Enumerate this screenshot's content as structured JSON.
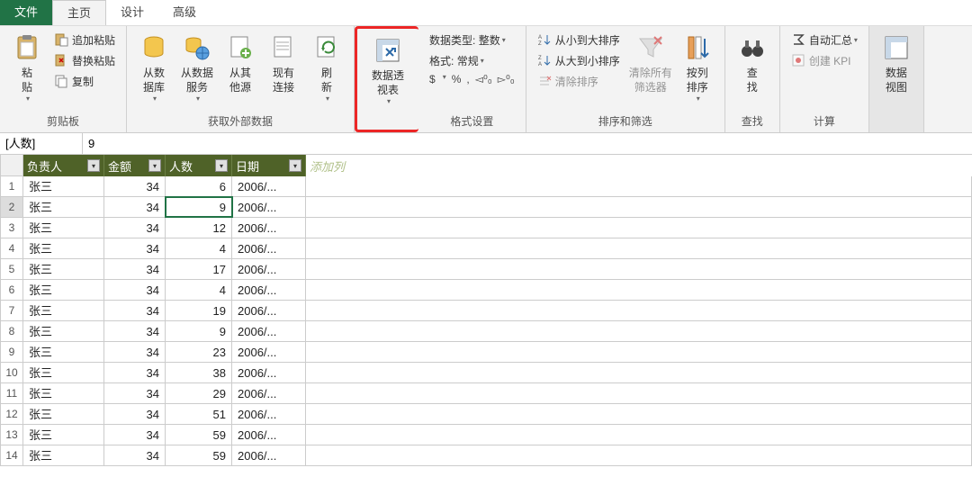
{
  "tabs": {
    "file": "文件",
    "home": "主页",
    "design": "设计",
    "advanced": "高级"
  },
  "ribbon": {
    "clipboard": {
      "label": "剪贴板",
      "paste": "粘\n贴",
      "append_paste": "追加粘贴",
      "replace_paste": "替换粘贴",
      "copy": "复制"
    },
    "external_data": {
      "label": "获取外部数据",
      "from_db": "从数\n据库",
      "from_svc": "从数据\n服务",
      "from_other": "从其\n他源",
      "existing": "现有\n连接",
      "refresh": "刷\n新"
    },
    "pivot": {
      "btn": "数据透\n视表"
    },
    "format": {
      "label": "格式设置",
      "type_label": "数据类型:",
      "type_val": "整数",
      "fmt_label": "格式:",
      "fmt_val": "常规",
      "currency": "$",
      "percent": "%",
      "comma": ",",
      "inc_dec": "◅⁰₀",
      "dec_dec": "▻⁰₀"
    },
    "sort": {
      "label": "排序和筛选",
      "asc": "从小到大排序",
      "desc": "从大到小排序",
      "clear": "清除排序",
      "clear_filters": "清除所有\n筛选器",
      "sort_col": "按列\n排序"
    },
    "find": {
      "label": "查找",
      "btn": "查\n找"
    },
    "calc": {
      "label": "计算",
      "autosum": "自动汇总",
      "kpi": "创建 KPI"
    },
    "pivot_chart": {
      "btn": "数据\n视图"
    }
  },
  "formula_bar": {
    "name": "[人数]",
    "value": "9"
  },
  "columns": {
    "c0": "负责人",
    "c1": "金额",
    "c2": "人数",
    "c3": "日期",
    "add": "添加列"
  },
  "rows": [
    {
      "n": "1",
      "c0": "张三",
      "c1": "34",
      "c2": "6",
      "c3": "2006/..."
    },
    {
      "n": "2",
      "c0": "张三",
      "c1": "34",
      "c2": "9",
      "c3": "2006/..."
    },
    {
      "n": "3",
      "c0": "张三",
      "c1": "34",
      "c2": "12",
      "c3": "2006/..."
    },
    {
      "n": "4",
      "c0": "张三",
      "c1": "34",
      "c2": "4",
      "c3": "2006/..."
    },
    {
      "n": "5",
      "c0": "张三",
      "c1": "34",
      "c2": "17",
      "c3": "2006/..."
    },
    {
      "n": "6",
      "c0": "张三",
      "c1": "34",
      "c2": "4",
      "c3": "2006/..."
    },
    {
      "n": "7",
      "c0": "张三",
      "c1": "34",
      "c2": "19",
      "c3": "2006/..."
    },
    {
      "n": "8",
      "c0": "张三",
      "c1": "34",
      "c2": "9",
      "c3": "2006/..."
    },
    {
      "n": "9",
      "c0": "张三",
      "c1": "34",
      "c2": "23",
      "c3": "2006/..."
    },
    {
      "n": "10",
      "c0": "张三",
      "c1": "34",
      "c2": "38",
      "c3": "2006/..."
    },
    {
      "n": "11",
      "c0": "张三",
      "c1": "34",
      "c2": "29",
      "c3": "2006/..."
    },
    {
      "n": "12",
      "c0": "张三",
      "c1": "34",
      "c2": "51",
      "c3": "2006/..."
    },
    {
      "n": "13",
      "c0": "张三",
      "c1": "34",
      "c2": "59",
      "c3": "2006/..."
    },
    {
      "n": "14",
      "c0": "张三",
      "c1": "34",
      "c2": "59",
      "c3": "2006/..."
    }
  ],
  "selected_row": 2
}
